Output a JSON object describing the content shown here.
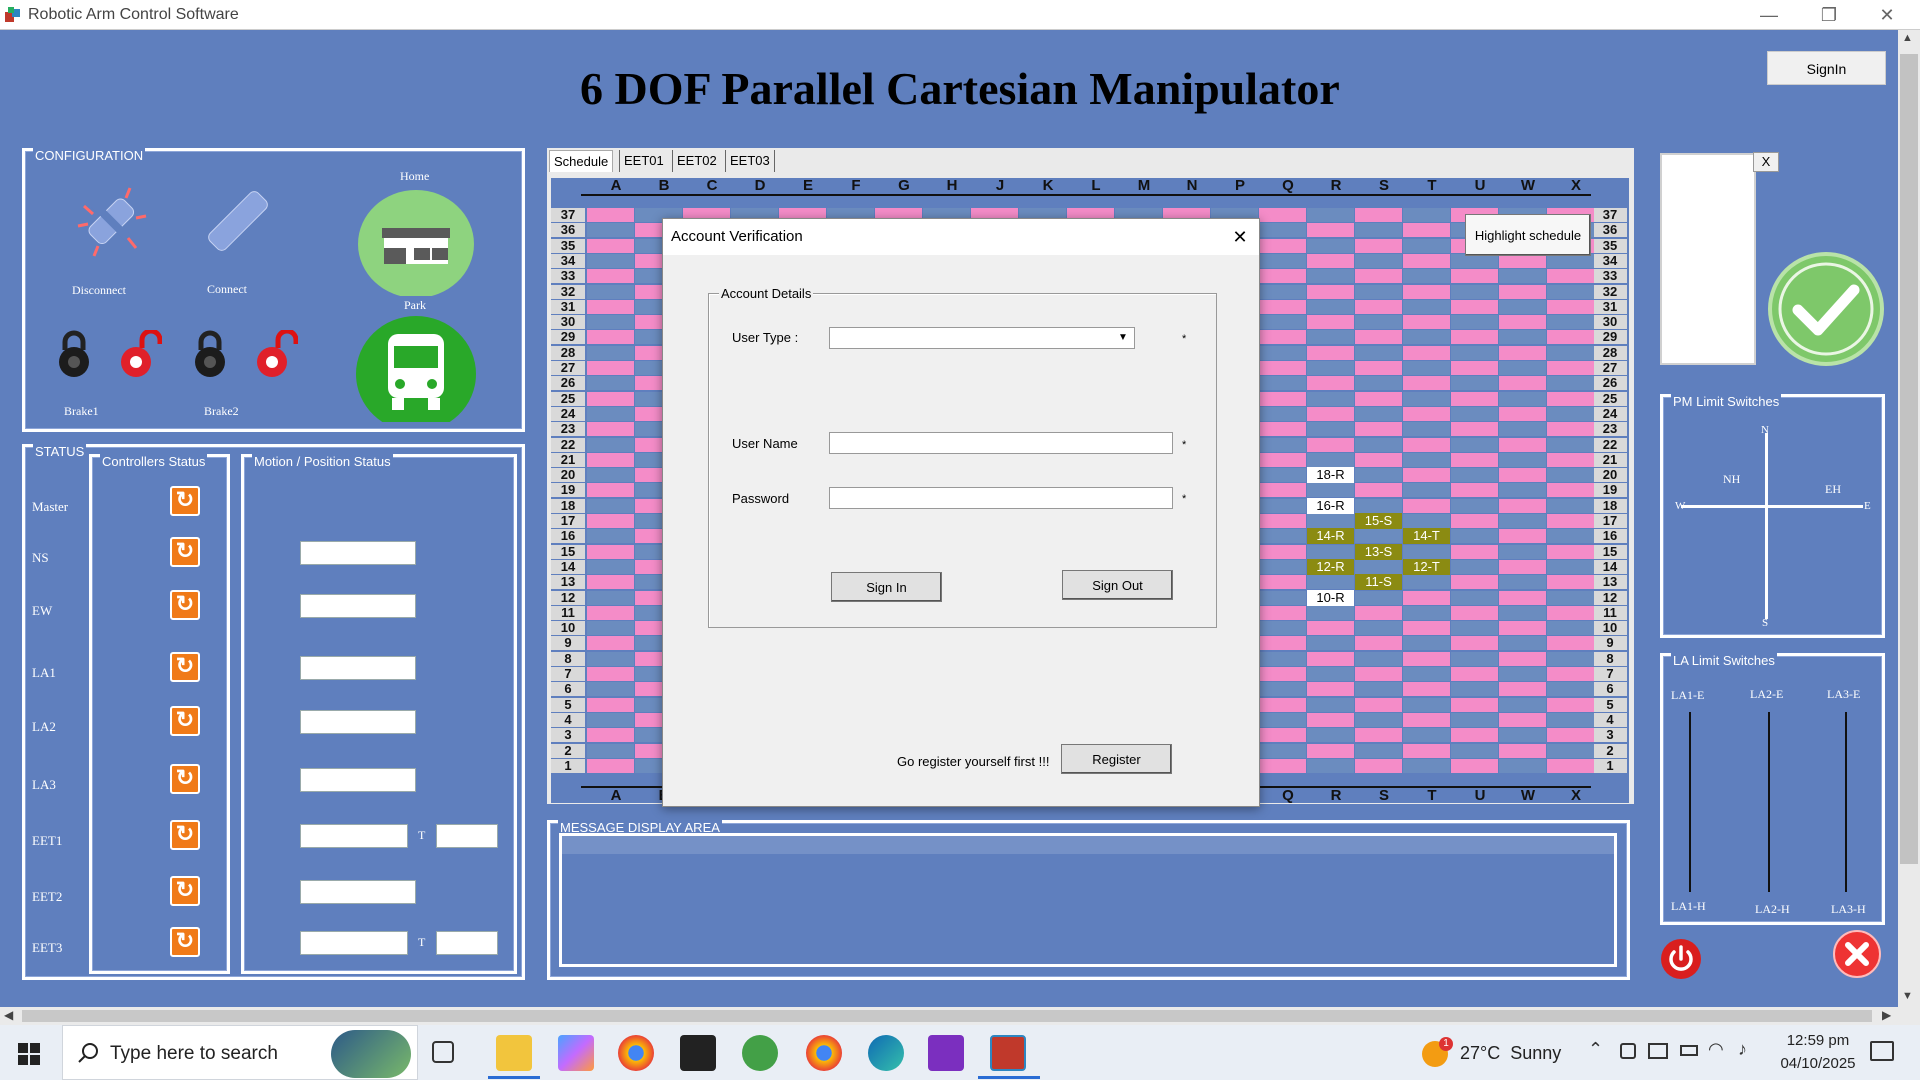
{
  "window": {
    "title": "Robotic Arm Control Software",
    "minimize": "—",
    "restore": "❐",
    "close": "✕"
  },
  "header": {
    "title": "6 DOF Parallel Cartesian Manipulator",
    "signin_label": "SignIn"
  },
  "configuration": {
    "title": "CONFIGURATION",
    "disconnect": "Disconnect",
    "connect": "Connect",
    "home": "Home",
    "park": "Park",
    "brake1": "Brake1",
    "brake2": "Brake2"
  },
  "status": {
    "title": "STATUS",
    "controllers_title": "Controllers Status",
    "motion_title": "Motion / Position Status",
    "rows": [
      "Master",
      "NS",
      "EW",
      "LA1",
      "LA2",
      "LA3",
      "EET1",
      "EET2",
      "EET3"
    ],
    "t_label": "T"
  },
  "schedule": {
    "tabs": [
      "Schedule",
      "EET01",
      "EET02",
      "EET03"
    ],
    "columns": [
      "A",
      "B",
      "C",
      "D",
      "E",
      "F",
      "G",
      "H",
      "J",
      "K",
      "L",
      "M",
      "N",
      "P",
      "Q",
      "R",
      "S",
      "T",
      "U",
      "W",
      "X"
    ],
    "rows": [
      "37",
      "36",
      "35",
      "34",
      "33",
      "32",
      "31",
      "30",
      "29",
      "28",
      "27",
      "26",
      "25",
      "24",
      "23",
      "22",
      "21",
      "20",
      "19",
      "18",
      "17",
      "16",
      "15",
      "14",
      "13",
      "12",
      "11",
      "10",
      "9",
      "8",
      "7",
      "6",
      "5",
      "4",
      "3",
      "2",
      "1"
    ],
    "highlight_label": "Highlight schedule",
    "markers": [
      {
        "label": "18-R",
        "style": "white"
      },
      {
        "label": "16-R",
        "style": "white"
      },
      {
        "label": "15-S",
        "style": "olive"
      },
      {
        "label": "14-R",
        "style": "olive"
      },
      {
        "label": "14-T",
        "style": "olive"
      },
      {
        "label": "13-S",
        "style": "olive"
      },
      {
        "label": "12-R",
        "style": "olive"
      },
      {
        "label": "12-T",
        "style": "olive"
      },
      {
        "label": "11-S",
        "style": "olive"
      },
      {
        "label": "10-R",
        "style": "white"
      }
    ]
  },
  "message_area": {
    "title": "MESSAGE DISPLAY AREA"
  },
  "side": {
    "close_x": "X",
    "pm_title": "PM Limit Switches",
    "compass": {
      "n": "N",
      "s": "S",
      "w": "W",
      "e": "E",
      "nh": "NH",
      "eh": "EH"
    },
    "la_title": "LA Limit Switches",
    "la_top": [
      "LA1-E",
      "LA2-E",
      "LA3-E"
    ],
    "la_bottom": [
      "LA1-H",
      "LA2-H",
      "LA3-H"
    ]
  },
  "dialog": {
    "title": "Account Verification",
    "close": "✕",
    "group_title": "Account Details",
    "user_type_label": "User Type :",
    "user_name_label": "User Name",
    "password_label": "Password",
    "required_mark": "*",
    "sign_in": "Sign In",
    "sign_out": "Sign Out",
    "register_prompt": "Go register yourself first !!!",
    "register": "Register"
  },
  "taskbar": {
    "search_placeholder": "Type here to search",
    "weather": "27°C  Sunny",
    "weather_badge": "1",
    "time": "12:59 pm",
    "date": "04/10/2025"
  },
  "colors": {
    "bg": "#5f7fbe",
    "pink": "#f48cc8",
    "blue": "#6b8cbf",
    "olive": "#8b8b12",
    "green": "#7ec86a",
    "orange": "#f07a18"
  }
}
